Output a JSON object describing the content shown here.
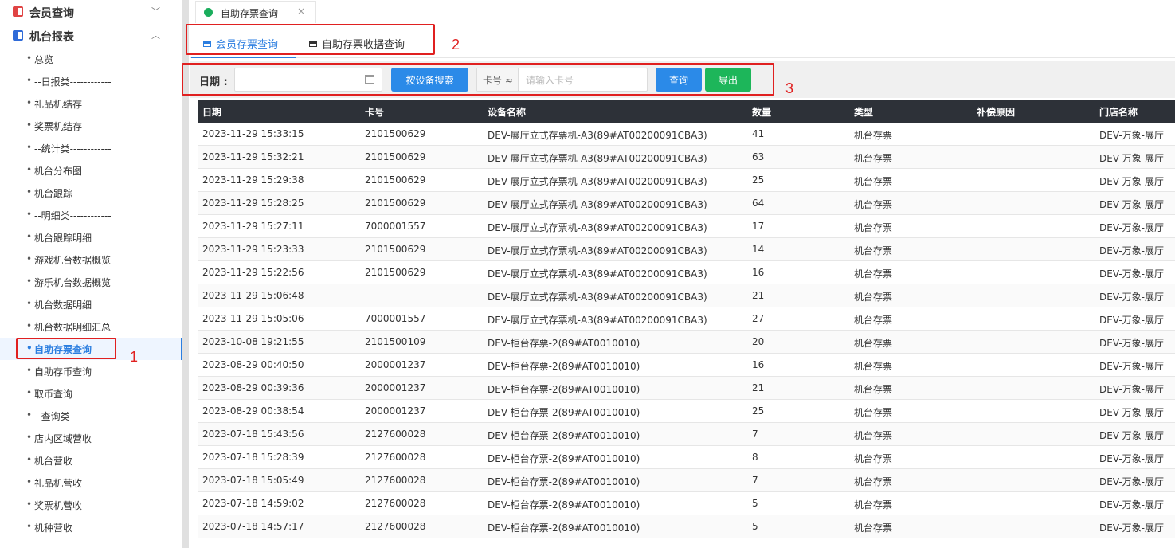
{
  "sidebar": {
    "groups": [
      {
        "label": "会员查询",
        "chevron": "chevron-down-icon"
      },
      {
        "label": "机台报表",
        "chevron": "chevron-up-icon"
      }
    ],
    "items": [
      "总览",
      "--日报类------------",
      "礼品机结存",
      "奖票机结存",
      "--统计类------------",
      "机台分布图",
      "机台跟踪",
      "--明细类------------",
      "机台跟踪明细",
      "游戏机台数据概览",
      "游乐机台数据概览",
      "机台数据明细",
      "机台数据明细汇总",
      "自助存票查询",
      "自助存币查询",
      "取币查询",
      "--查询类------------",
      "店内区域营收",
      "机台营收",
      "礼品机营收",
      "奖票机营收",
      "机种营收"
    ],
    "active_index": 13,
    "bullet": "•"
  },
  "annotations": [
    "1",
    "2",
    "3"
  ],
  "top_tab": {
    "label": "自助存票查询",
    "close": "×"
  },
  "sub_tabs": [
    {
      "label": "会员存票查询",
      "active": true
    },
    {
      "label": "自助存票收据查询",
      "active": false
    }
  ],
  "toolbar": {
    "date_label": "日期 :",
    "device_search_label": "按设备搜索",
    "card_label": "卡号 ≈",
    "card_placeholder": "请输入卡号",
    "query_label": "查询",
    "export_label": "导出"
  },
  "table": {
    "columns": [
      "日期",
      "卡号",
      "设备名称",
      "数量",
      "类型",
      "补偿原因",
      "门店名称"
    ],
    "rows": [
      [
        "2023-11-29 15:33:15",
        "2101500629",
        "DEV-展厅立式存票机-A3(89#AT00200091CBA3)",
        "41",
        "机台存票",
        "",
        "DEV-万象-展厅"
      ],
      [
        "2023-11-29 15:32:21",
        "2101500629",
        "DEV-展厅立式存票机-A3(89#AT00200091CBA3)",
        "63",
        "机台存票",
        "",
        "DEV-万象-展厅"
      ],
      [
        "2023-11-29 15:29:38",
        "2101500629",
        "DEV-展厅立式存票机-A3(89#AT00200091CBA3)",
        "25",
        "机台存票",
        "",
        "DEV-万象-展厅"
      ],
      [
        "2023-11-29 15:28:25",
        "2101500629",
        "DEV-展厅立式存票机-A3(89#AT00200091CBA3)",
        "64",
        "机台存票",
        "",
        "DEV-万象-展厅"
      ],
      [
        "2023-11-29 15:27:11",
        "7000001557",
        "DEV-展厅立式存票机-A3(89#AT00200091CBA3)",
        "17",
        "机台存票",
        "",
        "DEV-万象-展厅"
      ],
      [
        "2023-11-29 15:23:33",
        "2101500629",
        "DEV-展厅立式存票机-A3(89#AT00200091CBA3)",
        "14",
        "机台存票",
        "",
        "DEV-万象-展厅"
      ],
      [
        "2023-11-29 15:22:56",
        "2101500629",
        "DEV-展厅立式存票机-A3(89#AT00200091CBA3)",
        "16",
        "机台存票",
        "",
        "DEV-万象-展厅"
      ],
      [
        "2023-11-29 15:06:48",
        "",
        "DEV-展厅立式存票机-A3(89#AT00200091CBA3)",
        "21",
        "机台存票",
        "",
        "DEV-万象-展厅"
      ],
      [
        "2023-11-29 15:05:06",
        "7000001557",
        "DEV-展厅立式存票机-A3(89#AT00200091CBA3)",
        "27",
        "机台存票",
        "",
        "DEV-万象-展厅"
      ],
      [
        "2023-10-08 19:21:55",
        "2101500109",
        "DEV-柜台存票-2(89#AT0010010)",
        "20",
        "机台存票",
        "",
        "DEV-万象-展厅"
      ],
      [
        "2023-08-29 00:40:50",
        "2000001237",
        "DEV-柜台存票-2(89#AT0010010)",
        "16",
        "机台存票",
        "",
        "DEV-万象-展厅"
      ],
      [
        "2023-08-29 00:39:36",
        "2000001237",
        "DEV-柜台存票-2(89#AT0010010)",
        "21",
        "机台存票",
        "",
        "DEV-万象-展厅"
      ],
      [
        "2023-08-29 00:38:54",
        "2000001237",
        "DEV-柜台存票-2(89#AT0010010)",
        "25",
        "机台存票",
        "",
        "DEV-万象-展厅"
      ],
      [
        "2023-07-18 15:43:56",
        "2127600028",
        "DEV-柜台存票-2(89#AT0010010)",
        "7",
        "机台存票",
        "",
        "DEV-万象-展厅"
      ],
      [
        "2023-07-18 15:28:39",
        "2127600028",
        "DEV-柜台存票-2(89#AT0010010)",
        "8",
        "机台存票",
        "",
        "DEV-万象-展厅"
      ],
      [
        "2023-07-18 15:05:49",
        "2127600028",
        "DEV-柜台存票-2(89#AT0010010)",
        "7",
        "机台存票",
        "",
        "DEV-万象-展厅"
      ],
      [
        "2023-07-18 14:59:02",
        "2127600028",
        "DEV-柜台存票-2(89#AT0010010)",
        "5",
        "机台存票",
        "",
        "DEV-万象-展厅"
      ],
      [
        "2023-07-18 14:57:17",
        "2127600028",
        "DEV-柜台存票-2(89#AT0010010)",
        "5",
        "机台存票",
        "",
        "DEV-万象-展厅"
      ]
    ]
  },
  "colors": {
    "accent": "#2b7ee0",
    "annotation": "#e02020",
    "export": "#1db65a",
    "header": "#2d3138"
  }
}
